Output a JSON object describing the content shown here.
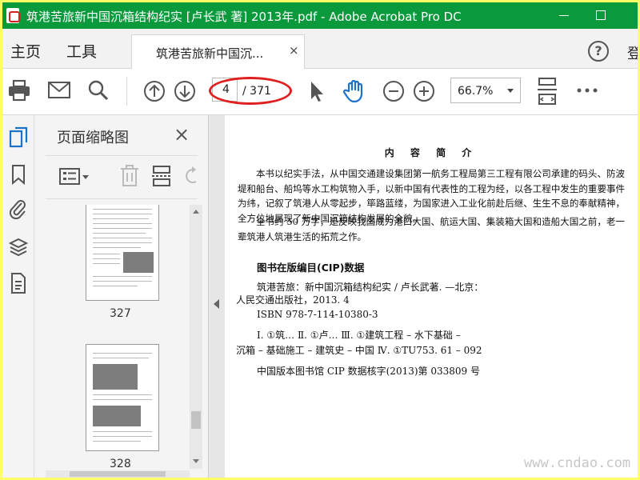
{
  "window": {
    "title": "筑港苦旅新中国沉箱结构纪实 [卢长武 著] 2013年.pdf - Adobe Acrobat Pro DC"
  },
  "menu": {
    "home": "主页",
    "tools": "工具",
    "doc_tab": "筑港苦旅新中国沉...",
    "close_tab": "×",
    "help": "?",
    "login": "登"
  },
  "toolbar": {
    "page_current": "4",
    "page_total": "/ 371",
    "zoom": "66.7%"
  },
  "panel": {
    "title": "页面缩略图",
    "close": "×",
    "thumbs": [
      {
        "label": "327"
      },
      {
        "label": "328"
      }
    ]
  },
  "document": {
    "heading": "内 容 简 介",
    "para1": "本书以纪实手法，从中国交通建设集团第一航务工程局第三工程有限公司承建的码头、防波堤和船台、船坞等水工构筑物入手，以新中国有代表性的工程为经，以各工程中发生的重要事件为纬，记叙了筑港人从零起步，筚路蓝缕，为国家进入工业化前赴后继、生生不息的奉献精神，全方位地展现了新中国沉箱结构发展的全貌。",
    "para2": "全书约 50 万字，是反映我国成为港口大国、航运大国、集装箱大国和造船大国之前，老一辈筑港人筑港生活的拓荒之作。",
    "cip_title": "图书在版编目(CIP)数据",
    "cip_line1": "筑港苦旅：新中国沉箱结构纪实 / 卢长武著. —北京：",
    "cip_line2": "人民交通出版社，2013. 4",
    "cip_line3": "ISBN 978-7-114-10380-3",
    "cip_line4": "Ⅰ. ①筑…   Ⅱ. ①卢…   Ⅲ. ①建筑工程 – 水下基础 –",
    "cip_line5": "沉箱 – 基础施工 – 建筑史 – 中国   Ⅳ. ①TU753. 61 – 092",
    "cip_line6": "中国版本图书馆 CIP 数据核字(2013)第 033809 号"
  },
  "watermark": "www.cndao.com"
}
